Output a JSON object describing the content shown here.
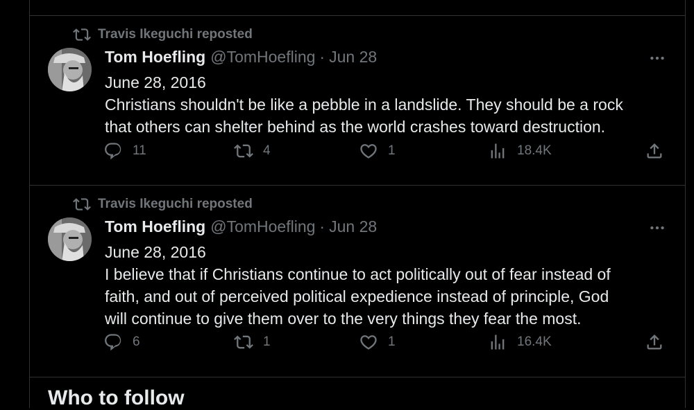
{
  "tweets": [
    {
      "reposted_by": "Travis Ikeguchi reposted",
      "author": {
        "name": "Tom Hoefling",
        "handle": "@TomHoefling",
        "date": "Jun 28"
      },
      "separator": "·",
      "text_lines": [
        "June 28, 2016",
        "Christians shouldn't be like a pebble in a landslide. They should be a rock",
        "that others can shelter behind as the world crashes toward destruction."
      ],
      "replies": "11",
      "reposts": "4",
      "likes": "1",
      "views": "18.4K"
    },
    {
      "reposted_by": "Travis Ikeguchi reposted",
      "author": {
        "name": "Tom Hoefling",
        "handle": "@TomHoefling",
        "date": "Jun 28"
      },
      "separator": "·",
      "text_lines": [
        "June 28, 2016",
        "I believe that if Christians continue to act politically out of fear instead of",
        "faith, and out of perceived political expedience instead of principle, God",
        "will continue to give them over to the very things they fear the most."
      ],
      "replies": "6",
      "reposts": "1",
      "likes": "1",
      "views": "16.4K"
    }
  ],
  "section_heading": "Who to follow",
  "icons": [
    "repost-icon",
    "more-icon",
    "reply-icon",
    "like-icon",
    "views-icon",
    "share-icon"
  ],
  "colors": {
    "background": "#000000",
    "text": "#e7e9ea",
    "muted": "#71767b",
    "border": "#2f3336"
  }
}
